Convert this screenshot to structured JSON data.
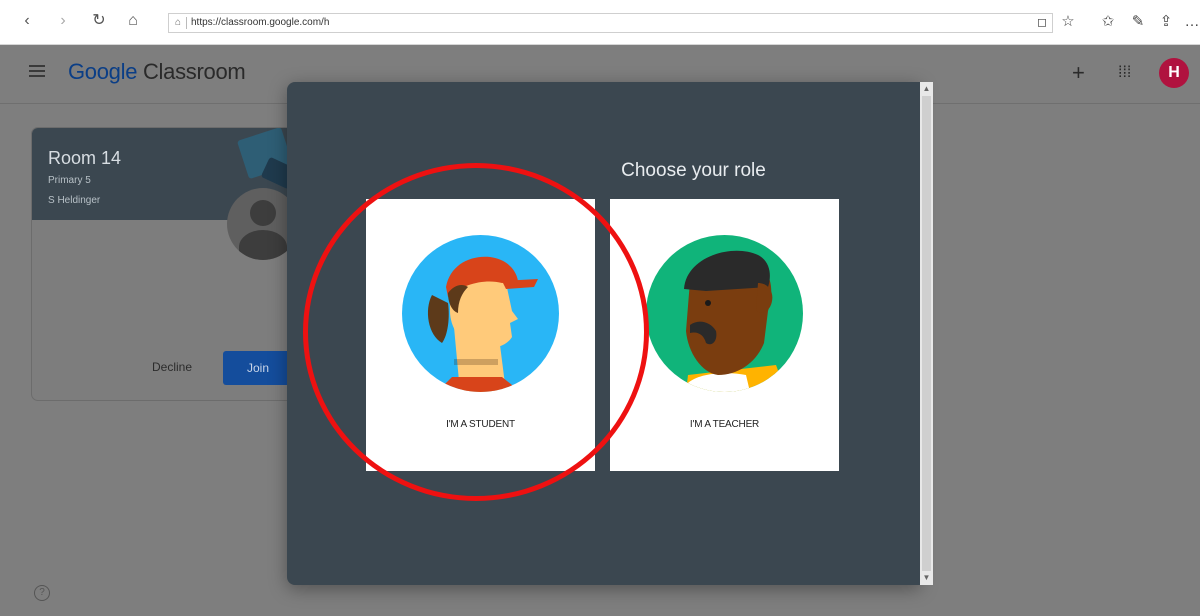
{
  "browser": {
    "url": "https://classroom.google.com/h",
    "icons": [
      "back-icon",
      "forward-icon",
      "refresh-icon",
      "home-icon",
      "lock-icon",
      "reading-view-icon",
      "favorite-star-icon",
      "favorites-list-icon",
      "pen-icon",
      "share-icon",
      "more-icon"
    ]
  },
  "app": {
    "logo_google": "Google",
    "logo_product": "Classroom",
    "avatar_initial": "H",
    "icons": [
      "hamburger-menu-icon",
      "plus-icon",
      "apps-grid-icon",
      "help-icon"
    ]
  },
  "class_card": {
    "title": "Room 14",
    "subtitle": "Primary 5",
    "teacher": "S Heldinger",
    "decline_label": "Decline",
    "join_label": "Join"
  },
  "dialog": {
    "title": "Choose your role",
    "student_label": "I'M A STUDENT",
    "teacher_label": "I'M A TEACHER"
  },
  "colors": {
    "dialog_bg": "#3b4750",
    "student_circle": "#29b6f6",
    "teacher_circle": "#10b47a",
    "highlight": "#ee1111",
    "join_button": "#144d9c"
  }
}
